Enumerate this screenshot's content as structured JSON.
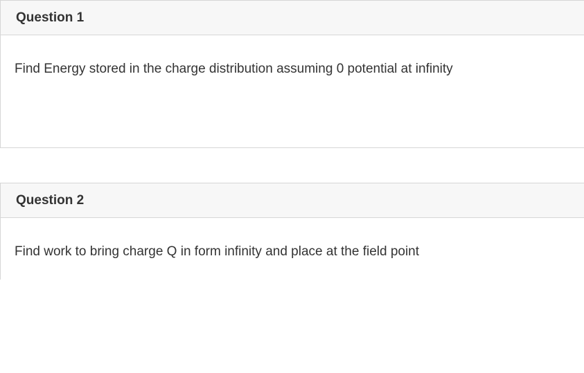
{
  "questions": [
    {
      "title": "Question 1",
      "body": "Find Energy stored in the charge distribution assuming 0 potential at infinity"
    },
    {
      "title": "Question 2",
      "body": "Find work to bring charge Q in form infinity and place at the field point"
    }
  ]
}
